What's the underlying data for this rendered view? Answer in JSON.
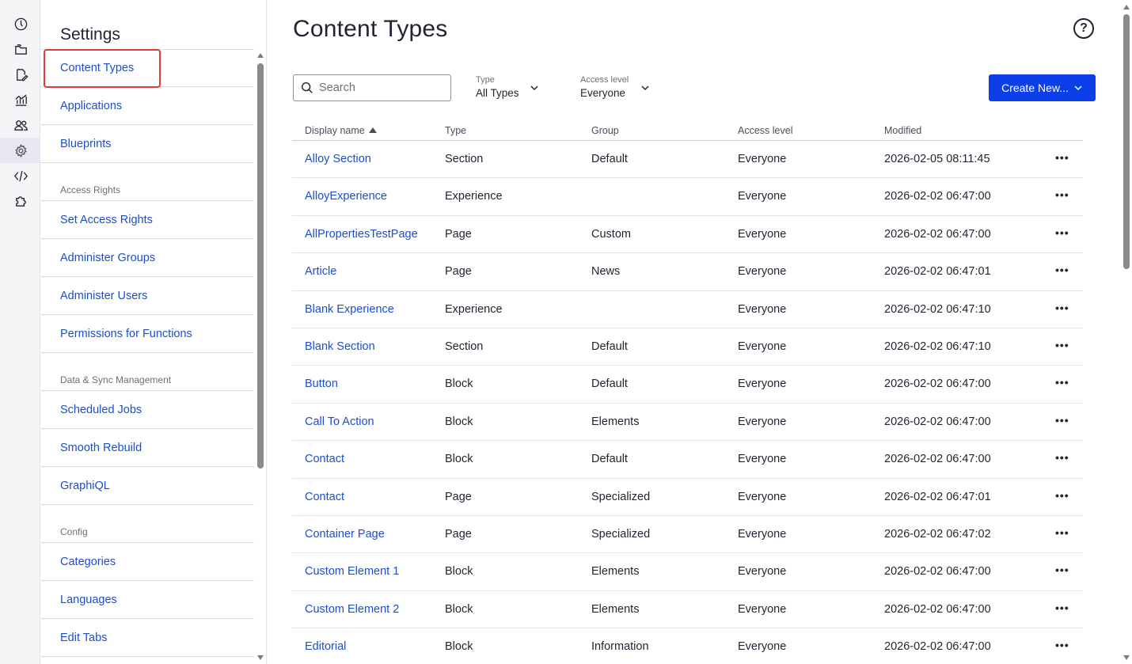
{
  "rail": {
    "icons": [
      "dashboard-icon",
      "folders-icon",
      "edit-icon",
      "analytics-icon",
      "users-icon",
      "gear-icon",
      "code-icon",
      "puzzle-icon"
    ]
  },
  "settings": {
    "title": "Settings",
    "groups": [
      {
        "section": "",
        "items": [
          "Content Types",
          "Applications",
          "Blueprints"
        ]
      },
      {
        "section": "Access Rights",
        "items": [
          "Set Access Rights",
          "Administer Groups",
          "Administer Users",
          "Permissions for Functions"
        ]
      },
      {
        "section": "Data & Sync Management",
        "items": [
          "Scheduled Jobs",
          "Smooth Rebuild",
          "GraphiQL"
        ]
      },
      {
        "section": "Config",
        "items": [
          "Categories",
          "Languages",
          "Edit Tabs"
        ]
      }
    ]
  },
  "main": {
    "title": "Content Types",
    "search": {
      "placeholder": "Search",
      "value": ""
    },
    "type_filter": {
      "label": "Type",
      "value": "All Types"
    },
    "access_filter": {
      "label": "Access level",
      "value": "Everyone"
    },
    "create_button": "Create New...",
    "columns": [
      "Display name",
      "Type",
      "Group",
      "Access level",
      "Modified"
    ],
    "rows": [
      [
        "Alloy Section",
        "Section",
        "Default",
        "Everyone",
        "2026-02-05 08:11:45"
      ],
      [
        "AlloyExperience",
        "Experience",
        "",
        "Everyone",
        "2026-02-02 06:47:00"
      ],
      [
        "AllPropertiesTestPage",
        "Page",
        "Custom",
        "Everyone",
        "2026-02-02 06:47:00"
      ],
      [
        "Article",
        "Page",
        "News",
        "Everyone",
        "2026-02-02 06:47:01"
      ],
      [
        "Blank Experience",
        "Experience",
        "",
        "Everyone",
        "2026-02-02 06:47:10"
      ],
      [
        "Blank Section",
        "Section",
        "Default",
        "Everyone",
        "2026-02-02 06:47:10"
      ],
      [
        "Button",
        "Block",
        "Default",
        "Everyone",
        "2026-02-02 06:47:00"
      ],
      [
        "Call To Action",
        "Block",
        "Elements",
        "Everyone",
        "2026-02-02 06:47:00"
      ],
      [
        "Contact",
        "Block",
        "Default",
        "Everyone",
        "2026-02-02 06:47:00"
      ],
      [
        "Contact",
        "Page",
        "Specialized",
        "Everyone",
        "2026-02-02 06:47:01"
      ],
      [
        "Container Page",
        "Page",
        "Specialized",
        "Everyone",
        "2026-02-02 06:47:02"
      ],
      [
        "Custom Element 1",
        "Block",
        "Elements",
        "Everyone",
        "2026-02-02 06:47:00"
      ],
      [
        "Custom Element 2",
        "Block",
        "Elements",
        "Everyone",
        "2026-02-02 06:47:00"
      ],
      [
        "Editorial",
        "Block",
        "Information",
        "Everyone",
        "2026-02-02 06:47:00"
      ]
    ],
    "row_menu": "•••"
  },
  "colors": {
    "accent": "#0d3fe8",
    "link": "#1a4fd0",
    "highlight": "#e03b3b"
  }
}
